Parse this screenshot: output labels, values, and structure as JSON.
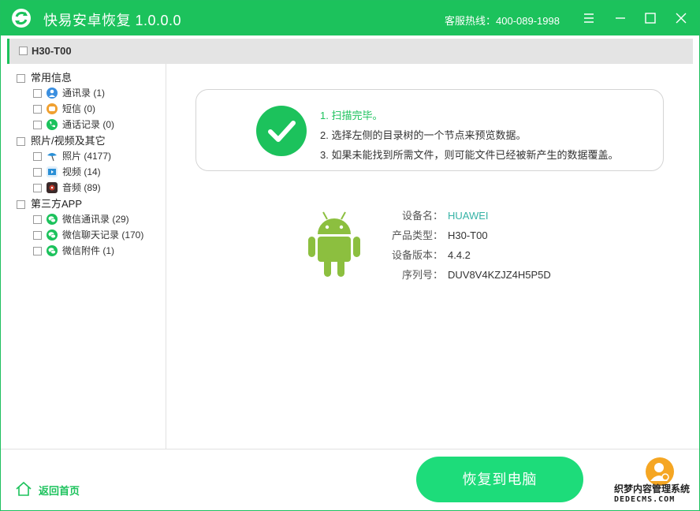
{
  "app": {
    "title": "快易安卓恢复  1.0.0.0",
    "hotline": "客服热线：400-089-1998",
    "brand_color": "#1cc25c"
  },
  "window_controls": [
    "menu-icon",
    "minimize-icon",
    "maximize-icon",
    "close-icon"
  ],
  "device": {
    "name": "H30-T00"
  },
  "sidebar": {
    "groups": [
      {
        "label": "常用信息",
        "items": [
          {
            "label": "通讯录 (1)",
            "icon": "contacts-icon",
            "color": "#3b8fe0"
          },
          {
            "label": "短信 (0)",
            "icon": "sms-icon",
            "color": "#f0a030"
          },
          {
            "label": "通话记录 (0)",
            "icon": "phone-icon",
            "color": "#1cc25c"
          }
        ]
      },
      {
        "label": "照片/视频及其它",
        "items": [
          {
            "label": "照片 (4177)",
            "icon": "photo-icon",
            "color": "#2a8fd6"
          },
          {
            "label": "视频 (14)",
            "icon": "video-icon",
            "color": "#2a8fd6"
          },
          {
            "label": "音频 (89)",
            "icon": "audio-icon",
            "color": "#c0392b"
          }
        ]
      },
      {
        "label": "第三方APP",
        "items": [
          {
            "label": "微信通讯录 (29)",
            "icon": "wechat-icon",
            "color": "#1cc25c"
          },
          {
            "label": "微信聊天记录 (170)",
            "icon": "wechat-icon",
            "color": "#1cc25c"
          },
          {
            "label": "微信附件 (1)",
            "icon": "wechat-icon",
            "color": "#1cc25c"
          }
        ]
      }
    ]
  },
  "status": {
    "steps": [
      "1. 扫描完毕。",
      "2. 选择左侧的目录树的一个节点来预览数据。",
      "3. 如果未能找到所需文件，则可能文件已经被新产生的数据覆盖。"
    ]
  },
  "device_info": {
    "rows": [
      {
        "key": "设备名：",
        "value": "HUAWEI"
      },
      {
        "key": "产品类型：",
        "value": "H30-T00"
      },
      {
        "key": "设备版本：",
        "value": "4.4.2"
      },
      {
        "key": "序列号：",
        "value": "DUV8V4KZJZ4H5P5D"
      }
    ],
    "android_color": "#8cbf3f"
  },
  "footer": {
    "home_label": "返回首页",
    "recover_label": "恢复到电脑",
    "watermark_line1": "织梦内容管理系统",
    "watermark_line2": "DEDECMS.COM"
  }
}
